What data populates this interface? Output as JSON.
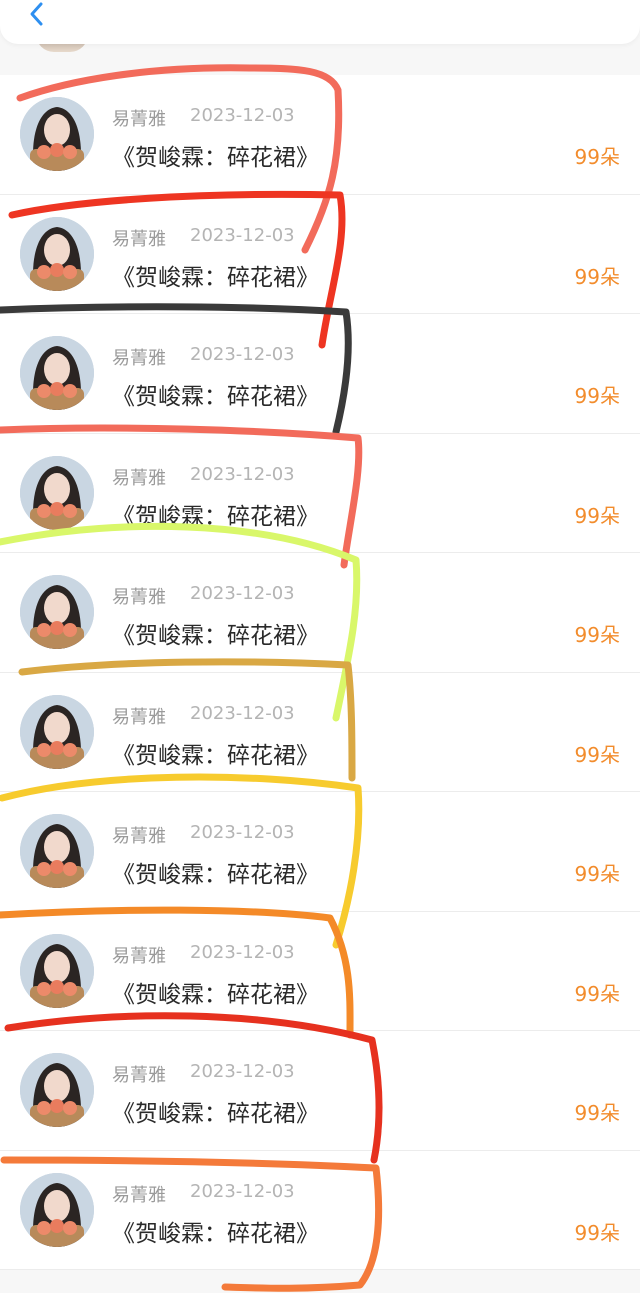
{
  "header": {
    "back_icon": "chevron-left-icon",
    "accent_color": "#2e8ff0"
  },
  "list": {
    "items": [
      {
        "name": "易菁雅",
        "date": "2023-12-03",
        "title": "《贺峻霖：碎花裙》",
        "flowers": "99朵"
      },
      {
        "name": "易菁雅",
        "date": "2023-12-03",
        "title": "《贺峻霖：碎花裙》",
        "flowers": "99朵"
      },
      {
        "name": "易菁雅",
        "date": "2023-12-03",
        "title": "《贺峻霖：碎花裙》",
        "flowers": "99朵"
      },
      {
        "name": "易菁雅",
        "date": "2023-12-03",
        "title": "《贺峻霖：碎花裙》",
        "flowers": "99朵"
      },
      {
        "name": "易菁雅",
        "date": "2023-12-03",
        "title": "《贺峻霖：碎花裙》",
        "flowers": "99朵"
      },
      {
        "name": "易菁雅",
        "date": "2023-12-03",
        "title": "《贺峻霖：碎花裙》",
        "flowers": "99朵"
      },
      {
        "name": "易菁雅",
        "date": "2023-12-03",
        "title": "《贺峻霖：碎花裙》",
        "flowers": "99朵"
      },
      {
        "name": "易菁雅",
        "date": "2023-12-03",
        "title": "《贺峻霖：碎花裙》",
        "flowers": "99朵"
      },
      {
        "name": "易菁雅",
        "date": "2023-12-03",
        "title": "《贺峻霖：碎花裙》",
        "flowers": "99朵"
      },
      {
        "name": "易菁雅",
        "date": "2023-12-03",
        "title": "《贺峻霖：碎花裙》",
        "flowers": "99朵"
      }
    ]
  },
  "colors": {
    "flower_count": "#f28c2c",
    "name": "#9a9a9a",
    "date": "#b4b4b4",
    "title": "#2a2a2a"
  },
  "annotation_colors": [
    "#f26b5b",
    "#ee3522",
    "#3a3a3a",
    "#f26b5b",
    "#d9f76a",
    "#d9a844",
    "#f7cb2e",
    "#f48a28",
    "#e6311f",
    "#f47a3a"
  ]
}
